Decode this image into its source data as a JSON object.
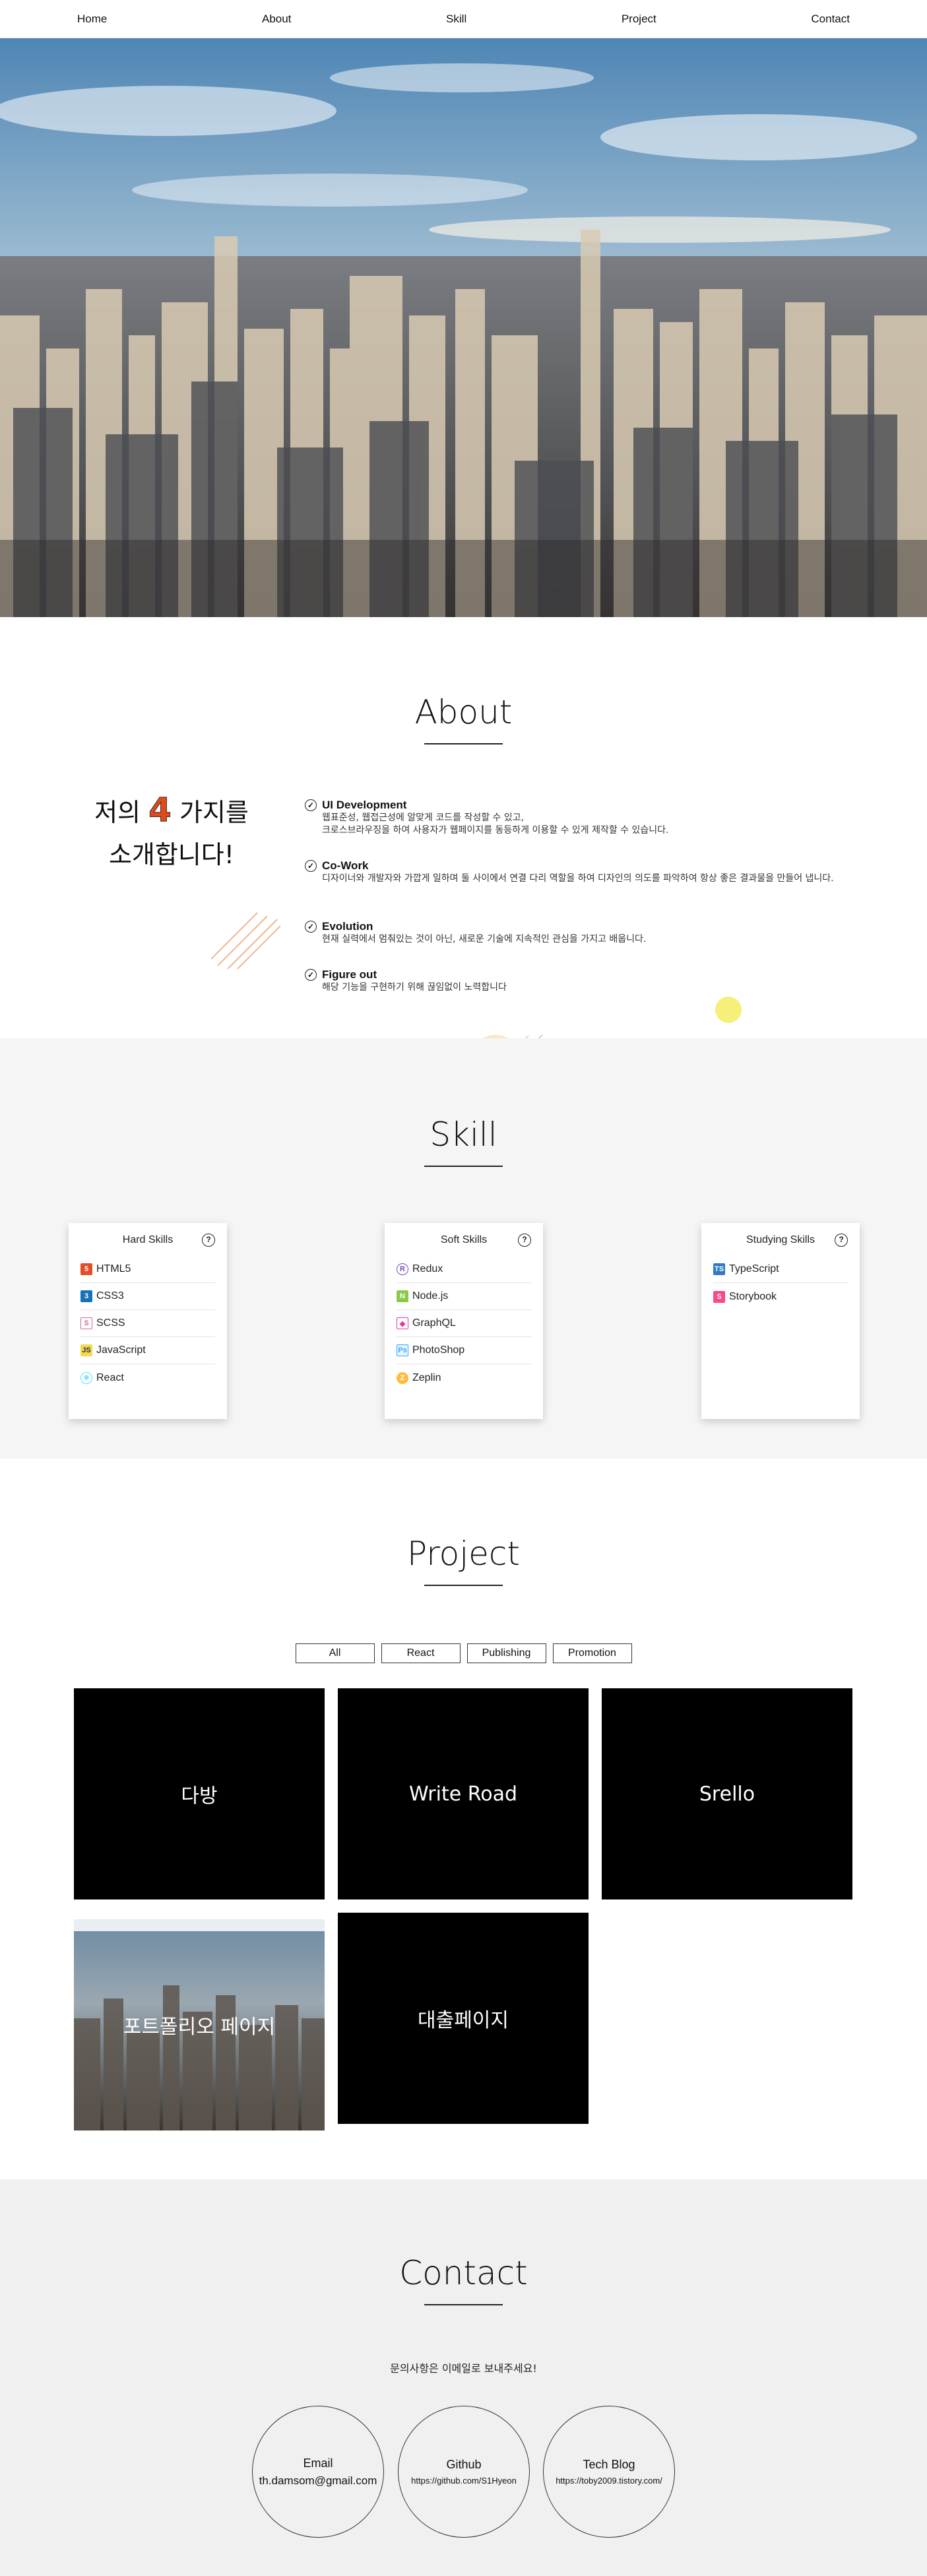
{
  "nav": {
    "items": [
      "Home",
      "About",
      "Skill",
      "Project",
      "Contact"
    ]
  },
  "about": {
    "title": "About",
    "intro_line1_pre": "저의",
    "intro_number": "4",
    "intro_line1_post": "가지를",
    "intro_line2": "소개합니다!",
    "items": [
      {
        "title": "UI Development",
        "desc": "웹표준성, 웹접근성에 알맞게 코드를 작성할 수 있고,\n크로스브라우징을 하여 사용자가 웹페이지를 동등하게 이용할 수 있게 제작할 수 있습니다."
      },
      {
        "title": "Co-Work",
        "desc": "디자이너와 개발자와 가깝게 일하며 둘 사이에서 연결 다리 역할을 하여 디자인의 의도를 파악하여 항상 좋은 결과물을 만들어 냅니다."
      },
      {
        "title": "Evolution",
        "desc": "현재 실력에서 멈춰있는 것이 아닌, 새로운 기술에 지속적인 관심을 가지고 배웁니다."
      },
      {
        "title": "Figure out",
        "desc": "해당 기능을 구현하기 위해 끊임없이 노력합니다"
      }
    ]
  },
  "skill": {
    "title": "Skill",
    "cards": [
      {
        "title": "Hard Skills",
        "items": [
          {
            "label": "HTML5",
            "icon": "html5-icon",
            "color": "#e44d26"
          },
          {
            "label": "CSS3",
            "icon": "css3-icon",
            "color": "#1572b6"
          },
          {
            "label": "SCSS",
            "icon": "sass-icon",
            "color": "#cd6799"
          },
          {
            "label": "JavaScript",
            "icon": "javascript-icon",
            "color": "#f0db4f"
          },
          {
            "label": "React",
            "icon": "react-icon",
            "color": "#61dafb"
          }
        ]
      },
      {
        "title": "Soft Skills",
        "items": [
          {
            "label": "Redux",
            "icon": "redux-icon",
            "color": "#764abc"
          },
          {
            "label": "Node.js",
            "icon": "nodejs-icon",
            "color": "#8cc84b"
          },
          {
            "label": "GraphQL",
            "icon": "graphql-icon",
            "color": "#e535ab"
          },
          {
            "label": "PhotoShop",
            "icon": "photoshop-icon",
            "color": "#31a8ff"
          },
          {
            "label": "Zeplin",
            "icon": "zeplin-icon",
            "color": "#fdbd39"
          }
        ]
      },
      {
        "title": "Studying Skills",
        "items": [
          {
            "label": "TypeScript",
            "icon": "typescript-icon",
            "color": "#3178c6"
          },
          {
            "label": "Storybook",
            "icon": "storybook-icon",
            "color": "#ff4785"
          }
        ]
      }
    ]
  },
  "project": {
    "title": "Project",
    "filters": [
      "All",
      "React",
      "Publishing",
      "Promotion"
    ],
    "items": [
      "다방",
      "Write Road",
      "Srello",
      "포트폴리오 페이지",
      "대출페이지"
    ]
  },
  "contact": {
    "title": "Contact",
    "message": "문의사항은 이메일로 보내주세요!",
    "email_title": "Email",
    "email_value": "th.damsom@gmail.com",
    "github_title": "Github",
    "github_value": "https://github.com/S1Hyeon",
    "blog_title": "Tech Blog",
    "blog_value": "https://toby2009.tistory.com/"
  }
}
